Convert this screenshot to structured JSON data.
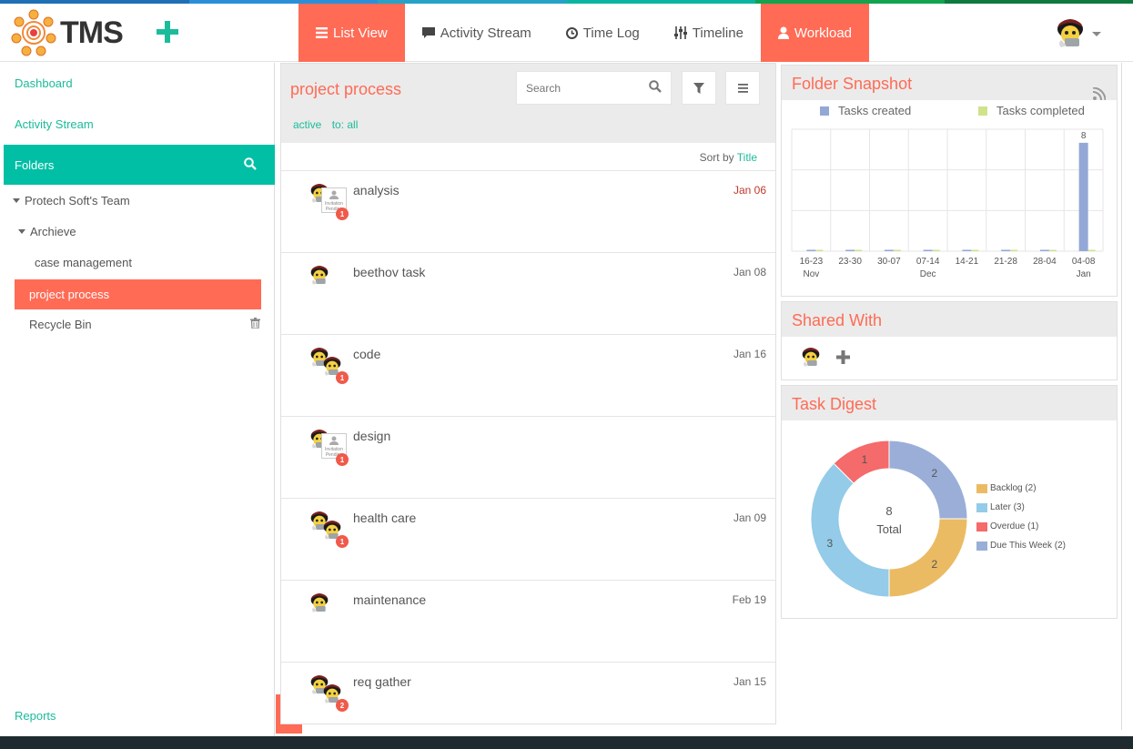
{
  "colors": {
    "accent": "#ff6b55",
    "teal": "#00bfa5",
    "link": "#1bbc9b",
    "strip": [
      "#1f6fb5",
      "#2a8fd8",
      "#27a2c7",
      "#0bb4a0",
      "#12a34f",
      "#0f7a3f"
    ]
  },
  "header": {
    "logo_text": "TMS",
    "add_icon": "plus-icon",
    "tabs": [
      {
        "label": "List View",
        "icon": "list-icon",
        "active": true
      },
      {
        "label": "Activity Stream",
        "icon": "comment-icon",
        "active": false
      },
      {
        "label": "Time Log",
        "icon": "clock-icon",
        "active": false
      },
      {
        "label": "Timeline",
        "icon": "sliders-icon",
        "active": false
      },
      {
        "label": "Workload",
        "icon": "user-icon",
        "active": false,
        "highlight": true
      }
    ]
  },
  "sidebar": {
    "dashboard": "Dashboard",
    "activity_stream": "Activity Stream",
    "folders_label": "Folders",
    "team": "Protech Soft's Team",
    "archive": "Archieve",
    "case_management": "case management",
    "project_process": "project process",
    "recycle_bin": "Recycle Bin",
    "reports": "Reports"
  },
  "main": {
    "title": "project process",
    "search_placeholder": "Search",
    "filter_active": "active",
    "filter_to": "to: all",
    "sort_label": "Sort by",
    "sort_value": "Title",
    "tasks": [
      {
        "name": "analysis",
        "date": "Jan 06",
        "overdue": true,
        "badge": "1",
        "invite": true,
        "double": false
      },
      {
        "name": "beethov task",
        "date": "Jan 08",
        "overdue": false,
        "badge": "",
        "invite": false,
        "double": false
      },
      {
        "name": "code",
        "date": "Jan 16",
        "overdue": false,
        "badge": "1",
        "invite": false,
        "double": true
      },
      {
        "name": "design",
        "date": "",
        "overdue": false,
        "badge": "1",
        "invite": true,
        "double": false
      },
      {
        "name": "health care",
        "date": "Jan 09",
        "overdue": false,
        "badge": "1",
        "invite": false,
        "double": true
      },
      {
        "name": "maintenance",
        "date": "Feb 19",
        "overdue": false,
        "badge": "",
        "invite": false,
        "double": false
      },
      {
        "name": "req gather",
        "date": "Jan 15",
        "overdue": false,
        "badge": "2",
        "invite": false,
        "double": true
      }
    ],
    "invite_text": "Invitation Pending"
  },
  "snapshot": {
    "title": "Folder Snapshot",
    "legend_created": "Tasks created",
    "legend_completed": "Tasks completed",
    "color_created": "#93a8d6",
    "color_completed": "#cfe38a"
  },
  "shared": {
    "title": "Shared With"
  },
  "digest": {
    "title": "Task Digest",
    "total_label": "Total"
  },
  "chart_data": [
    {
      "type": "bar",
      "title": "Folder Snapshot",
      "categories": [
        "16-23 Nov",
        "23-30",
        "30-07",
        "07-14 Dec",
        "14-21",
        "21-28",
        "28-04",
        "04-08 Jan"
      ],
      "tick_labels": [
        "16-23",
        "23-30",
        "30-07",
        "07-14",
        "14-21",
        "21-28",
        "28-04",
        "04-08"
      ],
      "tick_sublabels": [
        "Nov",
        "",
        "",
        "Dec",
        "",
        "",
        "",
        "Jan"
      ],
      "series": [
        {
          "name": "Tasks created",
          "values": [
            0,
            0,
            0,
            0,
            0,
            0,
            0,
            8
          ]
        },
        {
          "name": "Tasks completed",
          "values": [
            0,
            0,
            0,
            0,
            0,
            0,
            0,
            0
          ]
        }
      ],
      "ylim": [
        0,
        9
      ],
      "grid": true,
      "legend": "top"
    },
    {
      "type": "pie",
      "title": "Task Digest",
      "center_value": "8",
      "center_label": "Total",
      "slices": [
        {
          "name": "Backlog",
          "value": 2,
          "color": "#ebbb63",
          "legend": "Backlog (2)"
        },
        {
          "name": "Later",
          "value": 3,
          "color": "#93cbe8",
          "legend": "Later (3)"
        },
        {
          "name": "Overdue",
          "value": 1,
          "color": "#f56a6a",
          "legend": "Overdue (1)"
        },
        {
          "name": "Due This Week",
          "value": 2,
          "color": "#9aaed8",
          "legend": "Due This Week (2)"
        }
      ],
      "legend": "right"
    }
  ]
}
